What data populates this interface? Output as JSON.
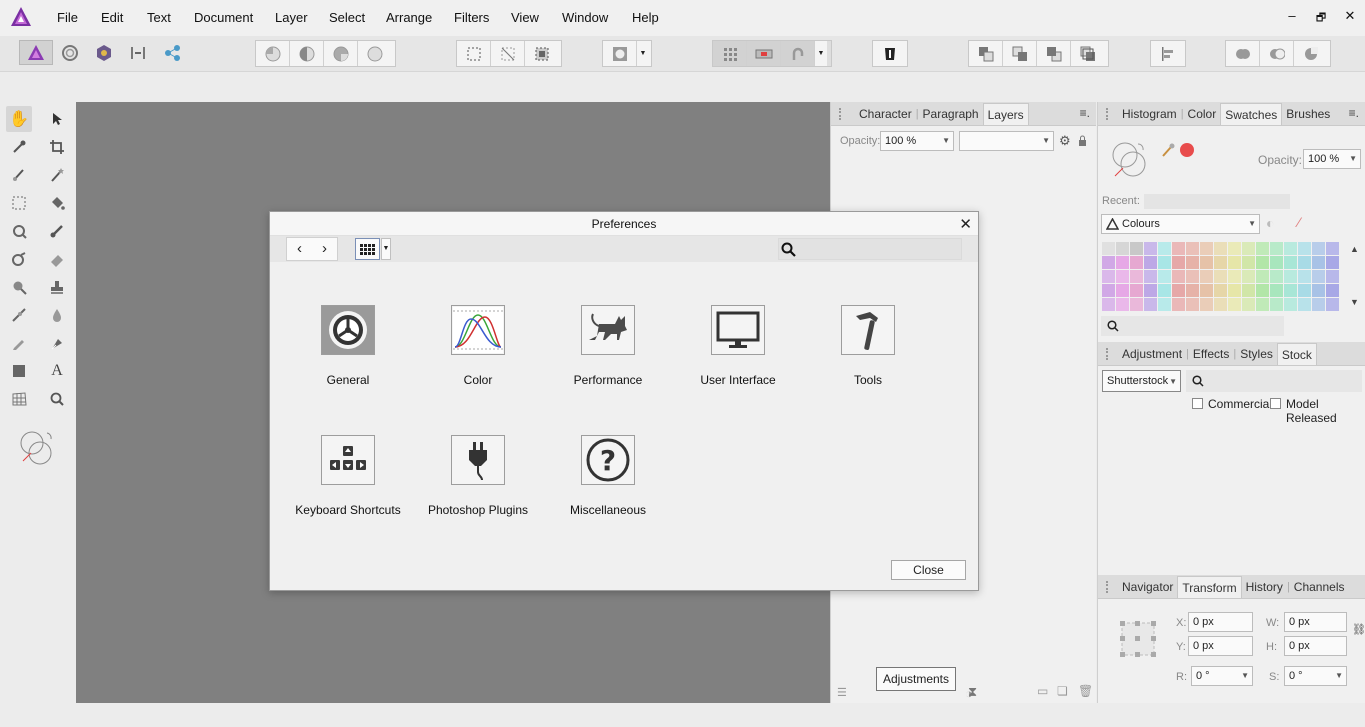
{
  "menu": {
    "items": [
      "File",
      "Edit",
      "Text",
      "Document",
      "Layer",
      "Select",
      "Arrange",
      "Filters",
      "View",
      "Window",
      "Help"
    ]
  },
  "window_controls": {
    "minimize": "–",
    "restore": "🗗",
    "close": "✕"
  },
  "layers_panel": {
    "tabs": [
      "Character",
      "Paragraph",
      "Layers"
    ],
    "active_tab": "Layers",
    "opacity_label": "Opacity:",
    "opacity_value": "100 %",
    "blend_value": ""
  },
  "color_panel": {
    "tabs": [
      "Histogram",
      "Color",
      "Swatches",
      "Brushes"
    ],
    "active_tab": "Swatches",
    "opacity_label": "Opacity:",
    "opacity_value": "100 %",
    "recent_label": "Recent:",
    "palette_value": "Colours",
    "current_color": "#e84c4c"
  },
  "stock_panel": {
    "tabs": [
      "Adjustment",
      "Effects",
      "Styles",
      "Stock"
    ],
    "active_tab": "Stock",
    "provider": "Shutterstock",
    "search_value": "",
    "commercial_label": "Commercial",
    "model_released_label": "Model Released"
  },
  "transform_panel": {
    "tabs": [
      "Navigator",
      "Transform",
      "History",
      "Channels"
    ],
    "active_tab": "Transform",
    "x_label": "X:",
    "x_value": "0 px",
    "y_label": "Y:",
    "y_value": "0 px",
    "w_label": "W:",
    "w_value": "0 px",
    "h_label": "H:",
    "h_value": "0 px",
    "r_label": "R:",
    "r_value": "0 °",
    "s_label": "S:",
    "s_value": "0 °"
  },
  "dialog": {
    "title": "Preferences",
    "search_value": "",
    "items": [
      {
        "label": "General",
        "icon": "gear-icon"
      },
      {
        "label": "Color",
        "icon": "color-curves-icon"
      },
      {
        "label": "Performance",
        "icon": "cat-icon"
      },
      {
        "label": "User Interface",
        "icon": "monitor-icon"
      },
      {
        "label": "Tools",
        "icon": "hammer-icon"
      },
      {
        "label": "Keyboard Shortcuts",
        "icon": "keyboard-icon"
      },
      {
        "label": "Photoshop Plugins",
        "icon": "plug-icon"
      },
      {
        "label": "Miscellaneous",
        "icon": "question-icon"
      }
    ],
    "close_label": "Close"
  },
  "tooltip": {
    "text": "Adjustments"
  }
}
